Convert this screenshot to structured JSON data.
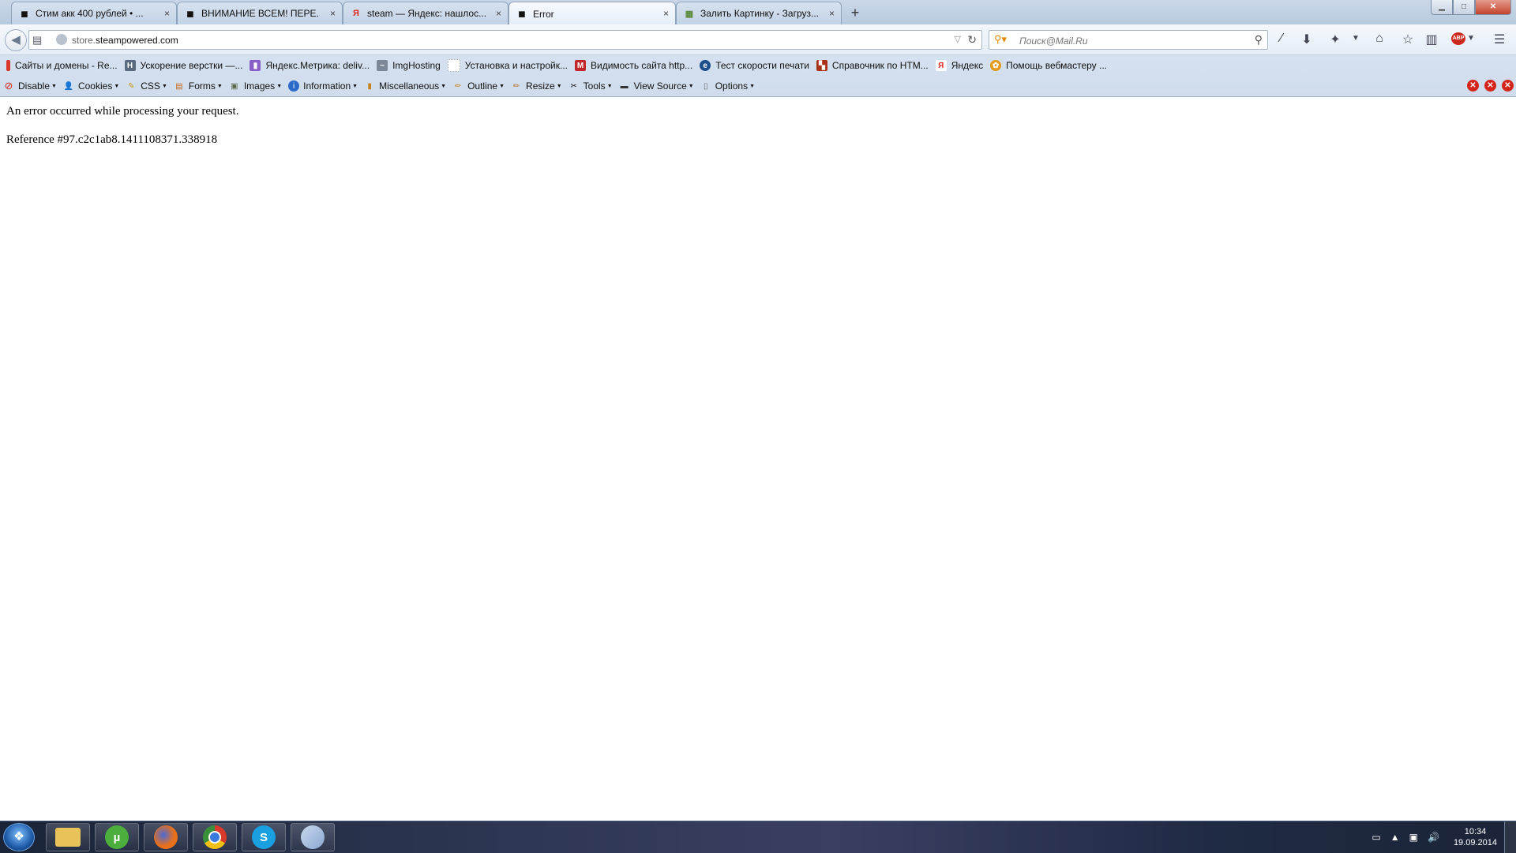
{
  "browser": {
    "tabs": [
      {
        "label": "Стим акк 400 рублей  •  ...",
        "icon": "steam-tab-icon",
        "active": false
      },
      {
        "label": "ВНИМАНИЕ ВСЕМ! ПЕРЕ...",
        "icon": "steam-tab-icon",
        "active": false
      },
      {
        "label": "steam — Яндекс: нашлос...",
        "icon": "yandex-tab-icon",
        "active": false
      },
      {
        "label": "Error",
        "icon": "steam-tab-icon",
        "active": true
      },
      {
        "label": "Залить Картинку - Загруз...",
        "icon": "image-tab-icon",
        "active": false
      }
    ],
    "tab_close_glyph": "×",
    "new_tab_glyph": "+",
    "window_buttons": {
      "minimize": "▁",
      "maximize": "□",
      "close": "✕"
    },
    "url": {
      "domain_prefix": "store.",
      "domain_main": "steampowered.com"
    },
    "search": {
      "placeholder": "Поиск@Mail.Ru"
    },
    "addon_badge": "ABP"
  },
  "bookmarks": [
    {
      "label": "Сайты и домены - Re...",
      "icon": "red-bars-icon",
      "color": "#d93a2b"
    },
    {
      "label": "Ускорение верстки —...",
      "icon": "h-box-icon",
      "color": "#5a6b80"
    },
    {
      "label": "Яндекс.Метрика: deliv...",
      "icon": "metrika-icon",
      "color": "#8a5fc8"
    },
    {
      "label": "ImgHosting",
      "icon": "imghosting-icon",
      "color": "#7a8898"
    },
    {
      "label": "Установка и настройк...",
      "icon": "dotted-box-icon",
      "color": "#9aa6b4"
    },
    {
      "label": "Видимость сайта http...",
      "icon": "mi-icon",
      "color": "#c3262a"
    },
    {
      "label": "Тест скорости печати",
      "icon": "globe-e-icon",
      "color": "#1f4e8c"
    },
    {
      "label": "Справочник по HTM...",
      "icon": "blocks-icon",
      "color": "#a83218"
    },
    {
      "label": "Яндекс",
      "icon": "yandex-icon",
      "color": "#e02a1f"
    },
    {
      "label": "Помощь вебмастеру ...",
      "icon": "webmaster-icon",
      "color": "#e59a1a"
    }
  ],
  "devtools": [
    {
      "label": "Disable",
      "icon": "disable-icon",
      "dropdown": true
    },
    {
      "label": "Cookies",
      "icon": "cookies-icon",
      "dropdown": true
    },
    {
      "label": "CSS",
      "icon": "css-icon",
      "dropdown": true
    },
    {
      "label": "Forms",
      "icon": "forms-icon",
      "dropdown": true
    },
    {
      "label": "Images",
      "icon": "images-icon",
      "dropdown": true
    },
    {
      "label": "Information",
      "icon": "information-icon",
      "dropdown": true
    },
    {
      "label": "Miscellaneous",
      "icon": "miscellaneous-icon",
      "dropdown": true
    },
    {
      "label": "Outline",
      "icon": "outline-icon",
      "dropdown": true
    },
    {
      "label": "Resize",
      "icon": "resize-icon",
      "dropdown": true
    },
    {
      "label": "Tools",
      "icon": "tools-icon",
      "dropdown": true
    },
    {
      "label": "View Source",
      "icon": "view-source-icon",
      "dropdown": true
    },
    {
      "label": "Options",
      "icon": "options-icon",
      "dropdown": true
    }
  ],
  "page": {
    "error_message": "An error occurred while processing your request.",
    "reference": "Reference #97.c2c1ab8.1411108371.338918"
  },
  "taskbar": {
    "apps": [
      {
        "name": "explorer",
        "icon": "folder-icon",
        "color": "#e8c35a"
      },
      {
        "name": "utorrent",
        "icon": "utorrent-icon",
        "color": "#4cae3c"
      },
      {
        "name": "firefox",
        "icon": "firefox-icon",
        "color": "#e8701a"
      },
      {
        "name": "chrome",
        "icon": "chrome-icon",
        "color": "#3a8f3a"
      },
      {
        "name": "skype",
        "icon": "skype-icon",
        "color": "#1aa0e0"
      },
      {
        "name": "paint",
        "icon": "paint-icon",
        "color": "#8aa8d0"
      }
    ],
    "app_glyphs": {
      "utorrent": "µ",
      "skype": "S"
    },
    "clock": {
      "time": "10:34",
      "date": "19.09.2014"
    }
  }
}
